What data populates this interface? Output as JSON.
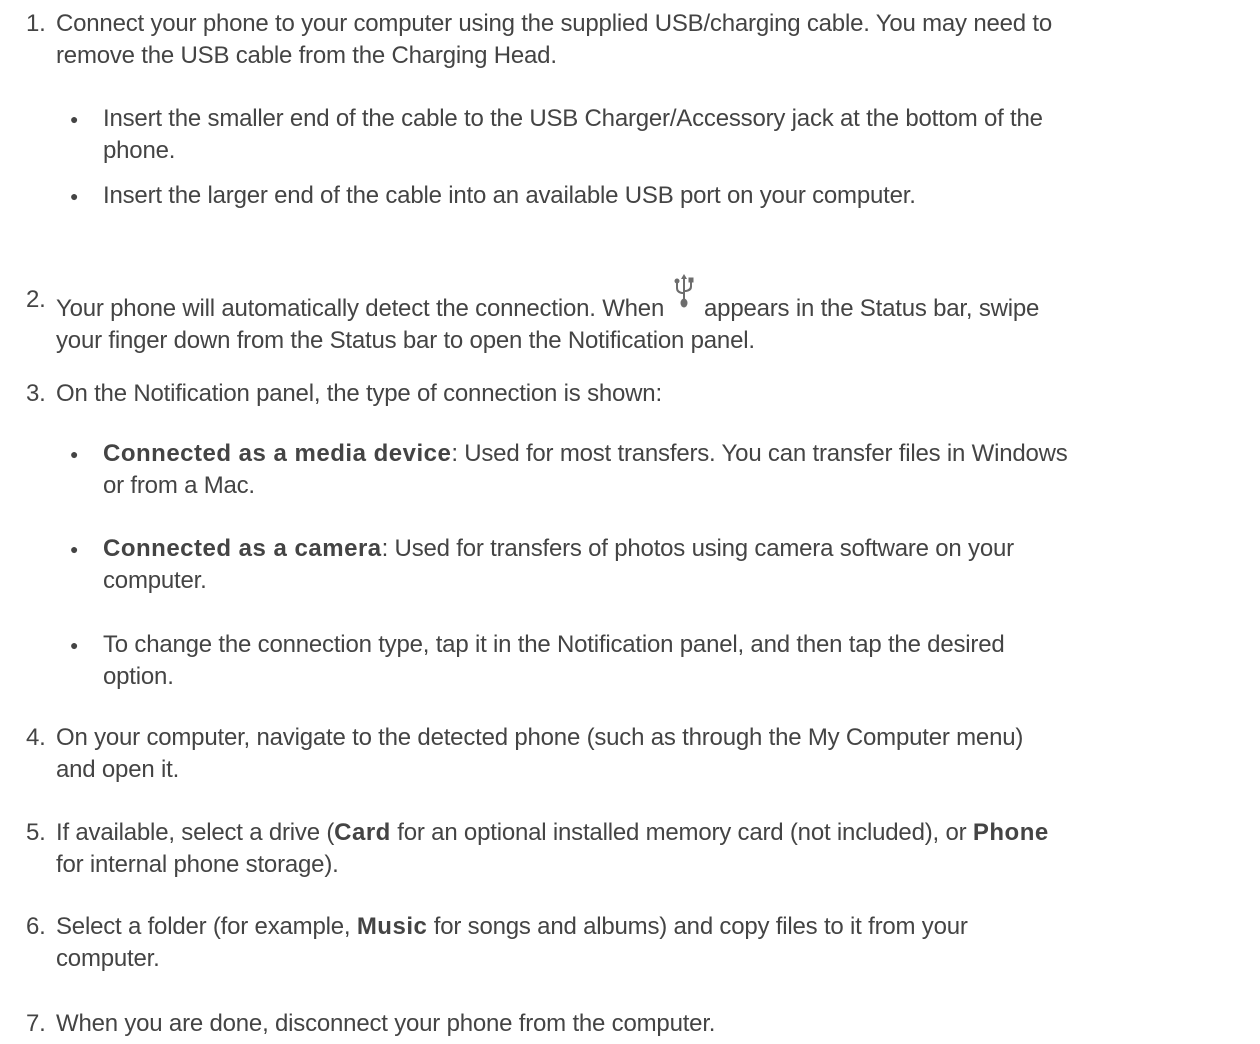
{
  "steps": [
    {
      "num": "1.",
      "lines": [
        "Connect your phone to your computer using the supplied USB/charging cable. You may need to",
        "remove the USB cable from the Charging Head."
      ]
    },
    {
      "num": "2.",
      "line1_a": "Your phone will automatically detect the connection. When ",
      "line1_b": " appears in the Status bar, swipe",
      "line2": "your finger down from the Status bar to open the Notification panel.",
      "icon": "usb-icon"
    },
    {
      "num": "3.",
      "lines": [
        "On the Notification panel, the type of connection is shown:"
      ]
    },
    {
      "num": "4.",
      "lines": [
        "On your computer, navigate to the detected phone (such as through the My Computer menu)",
        "and open it."
      ]
    },
    {
      "num": "5.",
      "line1_a": "If available, select a drive (",
      "card": "Card",
      "line1_b": " for an optional installed memory card (not included), or ",
      "phone": "Phone",
      "line2": "for internal phone storage)."
    },
    {
      "num": "6.",
      "line1_a": "Select a folder (for example, ",
      "music": "Music",
      "line1_b": " for songs and albums) and copy files to it from your",
      "line2": "computer."
    },
    {
      "num": "7.",
      "lines": [
        "When you are done, disconnect your phone from the computer."
      ]
    }
  ],
  "bullets_step1": [
    {
      "lines": [
        "Insert the smaller end of the cable to the USB Charger/Accessory jack at the bottom of the",
        "phone."
      ]
    },
    {
      "lines": [
        "Insert the larger end of the cable into an available USB port on your computer."
      ]
    }
  ],
  "bullets_step3": [
    {
      "term": "Connected as a media device",
      "line1": ": Used for most transfers. You can transfer files in Windows",
      "line2": "or from a Mac."
    },
    {
      "term": "Connected as a camera",
      "line1": ": Used for transfers of photos using camera software on your",
      "line2": "computer."
    },
    {
      "lines": [
        "To change the connection type, tap it in the Notification panel, and then tap the desired",
        "option."
      ]
    }
  ],
  "bullet_glyph": "●"
}
